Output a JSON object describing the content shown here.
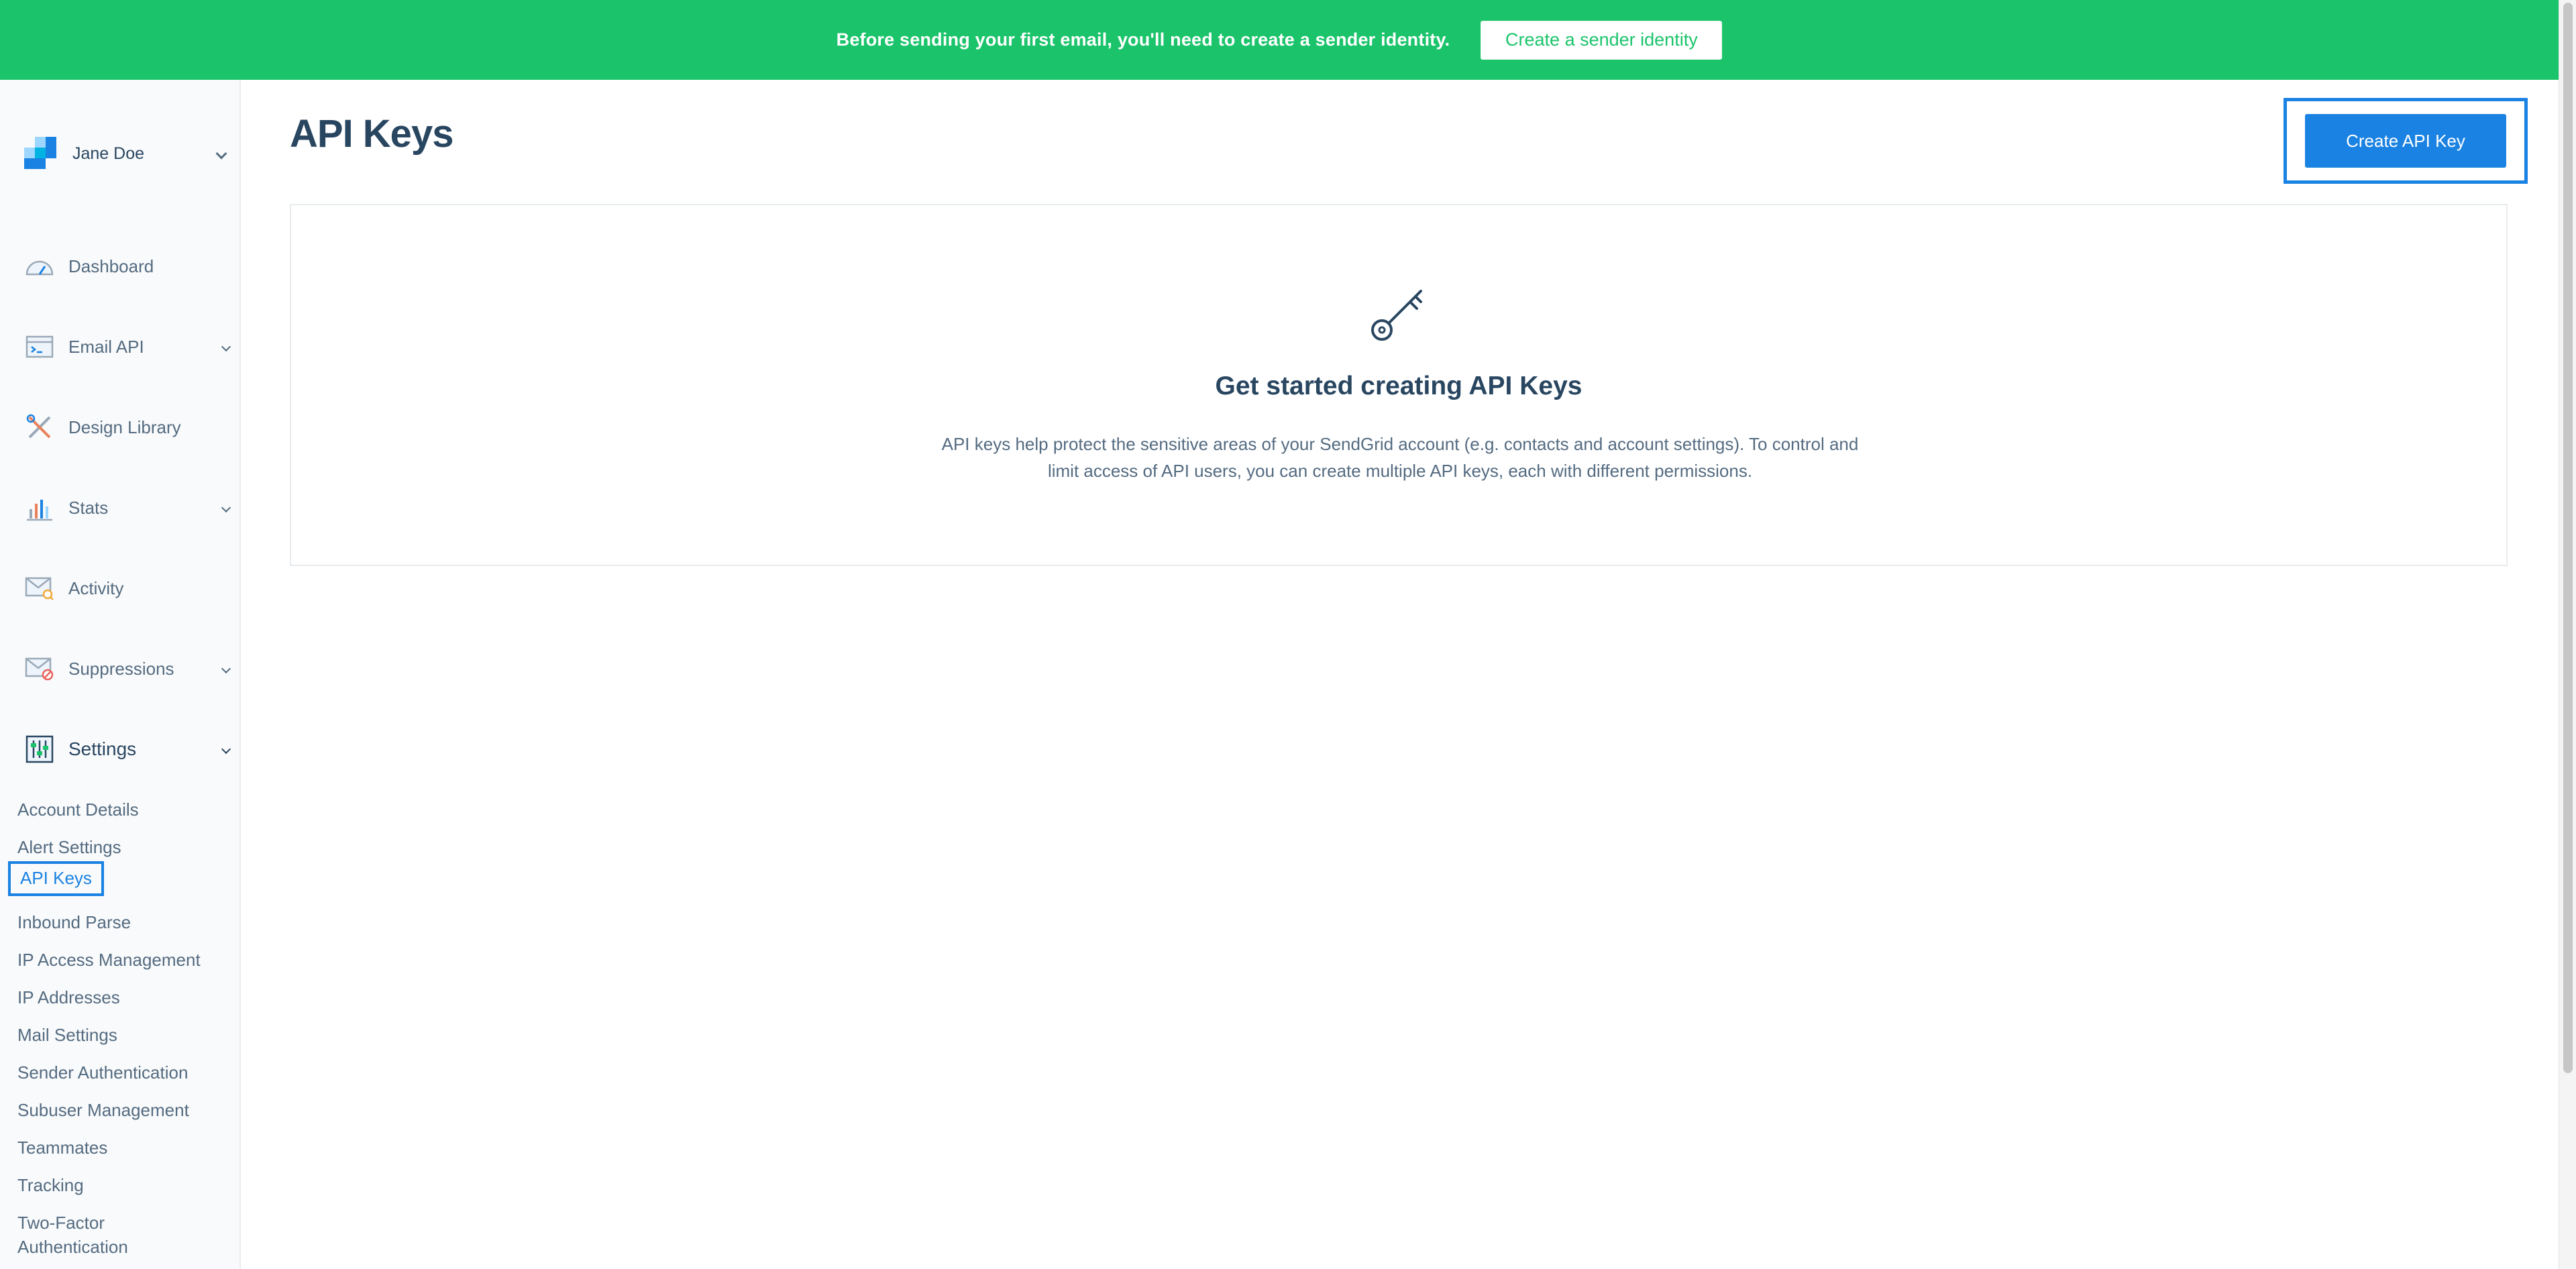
{
  "banner": {
    "message": "Before sending your first email, you'll need to create a sender identity.",
    "button_label": "Create a sender identity"
  },
  "sidebar": {
    "user_name": "Jane Doe",
    "nav": [
      {
        "label": "Dashboard",
        "icon": "dashboard-gauge-icon",
        "has_chevron": false
      },
      {
        "label": "Email API",
        "icon": "email-api-icon",
        "has_chevron": true
      },
      {
        "label": "Design Library",
        "icon": "design-library-icon",
        "has_chevron": false
      },
      {
        "label": "Stats",
        "icon": "stats-chart-icon",
        "has_chevron": true
      },
      {
        "label": "Activity",
        "icon": "activity-envelope-icon",
        "has_chevron": false
      },
      {
        "label": "Suppressions",
        "icon": "suppressions-envelope-icon",
        "has_chevron": true
      },
      {
        "label": "Settings",
        "icon": "settings-sliders-icon",
        "has_chevron": true,
        "expanded": true
      }
    ],
    "settings_items": [
      "Account Details",
      "Alert Settings",
      "API Keys",
      "Inbound Parse",
      "IP Access Management",
      "IP Addresses",
      "Mail Settings",
      "Sender Authentication",
      "Subuser Management",
      "Teammates",
      "Tracking",
      "Two-Factor",
      "Authentication"
    ],
    "selected_item": "API Keys"
  },
  "main": {
    "title": "API Keys",
    "create_button_label": "Create API Key",
    "empty_state": {
      "icon": "key-icon",
      "title": "Get started creating API Keys",
      "description_line1": "API keys help protect the sensitive areas of your SendGrid account (e.g. contacts and account settings). To control and",
      "description_line2": "limit access of API users, you can create multiple API keys, each with different permissions."
    }
  },
  "colors": {
    "banner": "#1bc46b",
    "primary": "#1a82e2",
    "text_dark": "#294661",
    "text_muted": "#546b81"
  }
}
